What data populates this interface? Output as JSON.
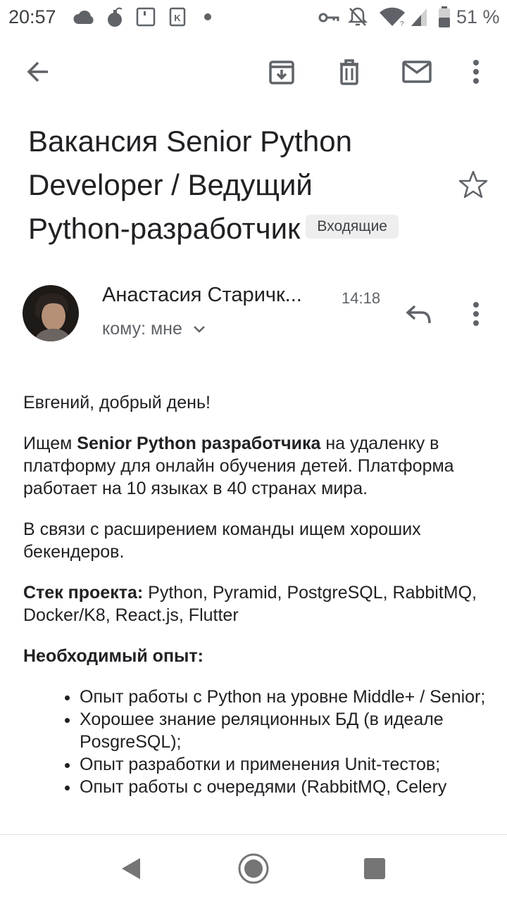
{
  "status_bar": {
    "time": "20:57",
    "battery_percent": "51 %",
    "icons": [
      "cloud-icon",
      "bomb-icon",
      "notification-box-icon",
      "k-app-icon",
      "dot-icon",
      "vpn-key-icon",
      "bell-off-icon",
      "wifi-icon",
      "signal-icon",
      "battery-icon"
    ]
  },
  "toolbar": {
    "back_icon": "arrow-back-icon",
    "archive_icon": "archive-icon",
    "delete_icon": "trash-icon",
    "mark_unread_icon": "mail-icon",
    "more_icon": "more-vert-icon"
  },
  "email": {
    "subject_line1": "Вакансия Senior Python",
    "subject_line2": "Developer / Ведущий",
    "subject_line3": "Python-разработчик",
    "label": "Входящие",
    "sender_name": "Анастасия Старичк...",
    "time": "14:18",
    "recipient": "кому: мне",
    "body": {
      "greeting": "Евгений, добрый день!",
      "p1_start": "Ищем ",
      "p1_bold": "Senior Python разработчика",
      "p1_end": " на удаленку в платформу для онлайн обучения детей. Платформа работает на 10 языках в 40 странах мира.",
      "p2": "В связи с расширением команды ищем хороших бекендеров.",
      "stack_label": "Стек проекта:",
      "stack_value": " Python, Pyramid, PostgreSQL, RabbitMQ, Docker/K8, React.js, Flutter",
      "experience_label": "Необходимый опыт:",
      "requirements": [
        "Опыт работы с Python на уровне Middle+ / Senior;",
        "Хорошее знание реляционных БД (в идеале PosgreSQL);",
        "Опыт разработки и применения Unit-тестов;",
        "Опыт работы с очередями (RabbitMQ, Celery"
      ]
    }
  },
  "nav_bar": {
    "back_icon": "nav-back-icon",
    "home_icon": "nav-home-icon",
    "recents_icon": "nav-recents-icon"
  },
  "colors": {
    "text_primary": "#202124",
    "text_secondary": "#5f6368",
    "icon": "#5f6368",
    "chip_bg": "#eeeeee"
  }
}
